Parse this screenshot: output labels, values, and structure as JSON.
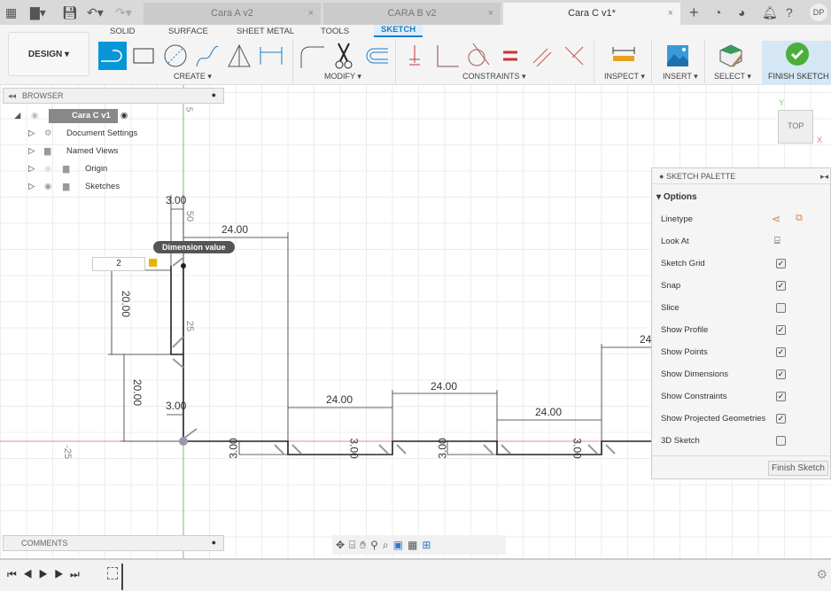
{
  "topbar": {
    "tabs": [
      {
        "label": "Cara A v2"
      },
      {
        "label": "CARA B v2"
      },
      {
        "label": "Cara C v1*"
      }
    ],
    "user_initials": "DP",
    "close_glyph": "×"
  },
  "ribbon": {
    "workspace": "DESIGN ▾",
    "tabs": [
      "SOLID",
      "SURFACE",
      "SHEET METAL",
      "TOOLS",
      "SKETCH"
    ],
    "active_tab": "SKETCH",
    "groups": [
      "CREATE ▾",
      "MODIFY ▾",
      "CONSTRAINTS ▾",
      "INSPECT ▾",
      "INSERT ▾",
      "SELECT ▾",
      "FINISH SKETCH ▾"
    ]
  },
  "browser": {
    "title": "BROWSER",
    "root": "Cara C v1",
    "items": [
      "Document Settings",
      "Named Views",
      "Origin",
      "Sketches"
    ]
  },
  "comments": {
    "title": "COMMENTS"
  },
  "sketch": {
    "dimensions": [
      "3.00",
      "24.00",
      "20.00",
      "20.00",
      "3.00",
      "24.00",
      "24.00",
      "24.00",
      "3.00",
      "3.00",
      "3.00",
      "3.00",
      "24"
    ],
    "axis_labels": [
      "5",
      "50",
      "25",
      "-25"
    ],
    "tooltip": "Dimension value",
    "input_value": "2"
  },
  "viewcube": {
    "face": "TOP",
    "x": "X",
    "y": "Y"
  },
  "palette": {
    "title": "SKETCH PALETTE",
    "section": "Options",
    "rows": [
      {
        "label": "Linetype"
      },
      {
        "label": "Look At"
      },
      {
        "label": "Sketch Grid",
        "checked": true
      },
      {
        "label": "Snap",
        "checked": true
      },
      {
        "label": "Slice",
        "checked": false
      },
      {
        "label": "Show Profile",
        "checked": true
      },
      {
        "label": "Show Points",
        "checked": true
      },
      {
        "label": "Show Dimensions",
        "checked": true
      },
      {
        "label": "Show Constraints",
        "checked": true
      },
      {
        "label": "Show Projected Geometries",
        "checked": true
      },
      {
        "label": "3D Sketch",
        "checked": false
      }
    ],
    "finish": "Finish Sketch"
  },
  "colors": {
    "accent": "#0696d7",
    "finish_green": "#4caf3a",
    "axis_green": "#6cc36c",
    "axis_red": "#e88"
  }
}
